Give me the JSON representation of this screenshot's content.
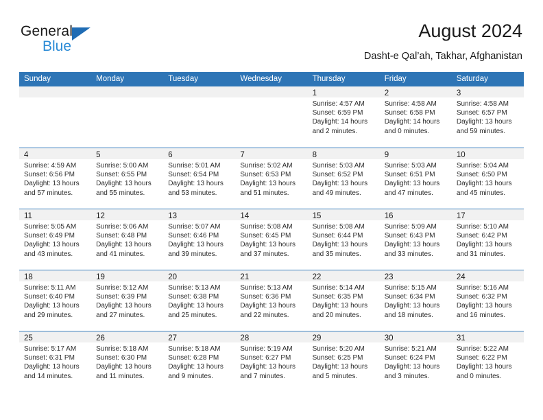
{
  "brand": {
    "name_top": "General",
    "name_bottom": "Blue",
    "triangle_icon": "blue-triangle-icon",
    "accent_color": "#2b8bd6",
    "triangle_color": "#1f6cb4"
  },
  "header": {
    "title": "August 2024",
    "subtitle": "Dasht-e Qal’ah, Takhar, Afghanistan"
  },
  "calendar": {
    "header_bg_color": "#2e75b6",
    "weekdays": [
      "Sunday",
      "Monday",
      "Tuesday",
      "Wednesday",
      "Thursday",
      "Friday",
      "Saturday"
    ],
    "weeks": [
      [
        {
          "day": "",
          "sunrise": "",
          "sunset": "",
          "daylight_line1": "",
          "daylight_line2": ""
        },
        {
          "day": "",
          "sunrise": "",
          "sunset": "",
          "daylight_line1": "",
          "daylight_line2": ""
        },
        {
          "day": "",
          "sunrise": "",
          "sunset": "",
          "daylight_line1": "",
          "daylight_line2": ""
        },
        {
          "day": "",
          "sunrise": "",
          "sunset": "",
          "daylight_line1": "",
          "daylight_line2": ""
        },
        {
          "day": "1",
          "sunrise": "Sunrise: 4:57 AM",
          "sunset": "Sunset: 6:59 PM",
          "daylight_line1": "Daylight: 14 hours",
          "daylight_line2": "and 2 minutes."
        },
        {
          "day": "2",
          "sunrise": "Sunrise: 4:58 AM",
          "sunset": "Sunset: 6:58 PM",
          "daylight_line1": "Daylight: 14 hours",
          "daylight_line2": "and 0 minutes."
        },
        {
          "day": "3",
          "sunrise": "Sunrise: 4:58 AM",
          "sunset": "Sunset: 6:57 PM",
          "daylight_line1": "Daylight: 13 hours",
          "daylight_line2": "and 59 minutes."
        }
      ],
      [
        {
          "day": "4",
          "sunrise": "Sunrise: 4:59 AM",
          "sunset": "Sunset: 6:56 PM",
          "daylight_line1": "Daylight: 13 hours",
          "daylight_line2": "and 57 minutes."
        },
        {
          "day": "5",
          "sunrise": "Sunrise: 5:00 AM",
          "sunset": "Sunset: 6:55 PM",
          "daylight_line1": "Daylight: 13 hours",
          "daylight_line2": "and 55 minutes."
        },
        {
          "day": "6",
          "sunrise": "Sunrise: 5:01 AM",
          "sunset": "Sunset: 6:54 PM",
          "daylight_line1": "Daylight: 13 hours",
          "daylight_line2": "and 53 minutes."
        },
        {
          "day": "7",
          "sunrise": "Sunrise: 5:02 AM",
          "sunset": "Sunset: 6:53 PM",
          "daylight_line1": "Daylight: 13 hours",
          "daylight_line2": "and 51 minutes."
        },
        {
          "day": "8",
          "sunrise": "Sunrise: 5:03 AM",
          "sunset": "Sunset: 6:52 PM",
          "daylight_line1": "Daylight: 13 hours",
          "daylight_line2": "and 49 minutes."
        },
        {
          "day": "9",
          "sunrise": "Sunrise: 5:03 AM",
          "sunset": "Sunset: 6:51 PM",
          "daylight_line1": "Daylight: 13 hours",
          "daylight_line2": "and 47 minutes."
        },
        {
          "day": "10",
          "sunrise": "Sunrise: 5:04 AM",
          "sunset": "Sunset: 6:50 PM",
          "daylight_line1": "Daylight: 13 hours",
          "daylight_line2": "and 45 minutes."
        }
      ],
      [
        {
          "day": "11",
          "sunrise": "Sunrise: 5:05 AM",
          "sunset": "Sunset: 6:49 PM",
          "daylight_line1": "Daylight: 13 hours",
          "daylight_line2": "and 43 minutes."
        },
        {
          "day": "12",
          "sunrise": "Sunrise: 5:06 AM",
          "sunset": "Sunset: 6:48 PM",
          "daylight_line1": "Daylight: 13 hours",
          "daylight_line2": "and 41 minutes."
        },
        {
          "day": "13",
          "sunrise": "Sunrise: 5:07 AM",
          "sunset": "Sunset: 6:46 PM",
          "daylight_line1": "Daylight: 13 hours",
          "daylight_line2": "and 39 minutes."
        },
        {
          "day": "14",
          "sunrise": "Sunrise: 5:08 AM",
          "sunset": "Sunset: 6:45 PM",
          "daylight_line1": "Daylight: 13 hours",
          "daylight_line2": "and 37 minutes."
        },
        {
          "day": "15",
          "sunrise": "Sunrise: 5:08 AM",
          "sunset": "Sunset: 6:44 PM",
          "daylight_line1": "Daylight: 13 hours",
          "daylight_line2": "and 35 minutes."
        },
        {
          "day": "16",
          "sunrise": "Sunrise: 5:09 AM",
          "sunset": "Sunset: 6:43 PM",
          "daylight_line1": "Daylight: 13 hours",
          "daylight_line2": "and 33 minutes."
        },
        {
          "day": "17",
          "sunrise": "Sunrise: 5:10 AM",
          "sunset": "Sunset: 6:42 PM",
          "daylight_line1": "Daylight: 13 hours",
          "daylight_line2": "and 31 minutes."
        }
      ],
      [
        {
          "day": "18",
          "sunrise": "Sunrise: 5:11 AM",
          "sunset": "Sunset: 6:40 PM",
          "daylight_line1": "Daylight: 13 hours",
          "daylight_line2": "and 29 minutes."
        },
        {
          "day": "19",
          "sunrise": "Sunrise: 5:12 AM",
          "sunset": "Sunset: 6:39 PM",
          "daylight_line1": "Daylight: 13 hours",
          "daylight_line2": "and 27 minutes."
        },
        {
          "day": "20",
          "sunrise": "Sunrise: 5:13 AM",
          "sunset": "Sunset: 6:38 PM",
          "daylight_line1": "Daylight: 13 hours",
          "daylight_line2": "and 25 minutes."
        },
        {
          "day": "21",
          "sunrise": "Sunrise: 5:13 AM",
          "sunset": "Sunset: 6:36 PM",
          "daylight_line1": "Daylight: 13 hours",
          "daylight_line2": "and 22 minutes."
        },
        {
          "day": "22",
          "sunrise": "Sunrise: 5:14 AM",
          "sunset": "Sunset: 6:35 PM",
          "daylight_line1": "Daylight: 13 hours",
          "daylight_line2": "and 20 minutes."
        },
        {
          "day": "23",
          "sunrise": "Sunrise: 5:15 AM",
          "sunset": "Sunset: 6:34 PM",
          "daylight_line1": "Daylight: 13 hours",
          "daylight_line2": "and 18 minutes."
        },
        {
          "day": "24",
          "sunrise": "Sunrise: 5:16 AM",
          "sunset": "Sunset: 6:32 PM",
          "daylight_line1": "Daylight: 13 hours",
          "daylight_line2": "and 16 minutes."
        }
      ],
      [
        {
          "day": "25",
          "sunrise": "Sunrise: 5:17 AM",
          "sunset": "Sunset: 6:31 PM",
          "daylight_line1": "Daylight: 13 hours",
          "daylight_line2": "and 14 minutes."
        },
        {
          "day": "26",
          "sunrise": "Sunrise: 5:18 AM",
          "sunset": "Sunset: 6:30 PM",
          "daylight_line1": "Daylight: 13 hours",
          "daylight_line2": "and 11 minutes."
        },
        {
          "day": "27",
          "sunrise": "Sunrise: 5:18 AM",
          "sunset": "Sunset: 6:28 PM",
          "daylight_line1": "Daylight: 13 hours",
          "daylight_line2": "and 9 minutes."
        },
        {
          "day": "28",
          "sunrise": "Sunrise: 5:19 AM",
          "sunset": "Sunset: 6:27 PM",
          "daylight_line1": "Daylight: 13 hours",
          "daylight_line2": "and 7 minutes."
        },
        {
          "day": "29",
          "sunrise": "Sunrise: 5:20 AM",
          "sunset": "Sunset: 6:25 PM",
          "daylight_line1": "Daylight: 13 hours",
          "daylight_line2": "and 5 minutes."
        },
        {
          "day": "30",
          "sunrise": "Sunrise: 5:21 AM",
          "sunset": "Sunset: 6:24 PM",
          "daylight_line1": "Daylight: 13 hours",
          "daylight_line2": "and 3 minutes."
        },
        {
          "day": "31",
          "sunrise": "Sunrise: 5:22 AM",
          "sunset": "Sunset: 6:22 PM",
          "daylight_line1": "Daylight: 13 hours",
          "daylight_line2": "and 0 minutes."
        }
      ]
    ]
  }
}
